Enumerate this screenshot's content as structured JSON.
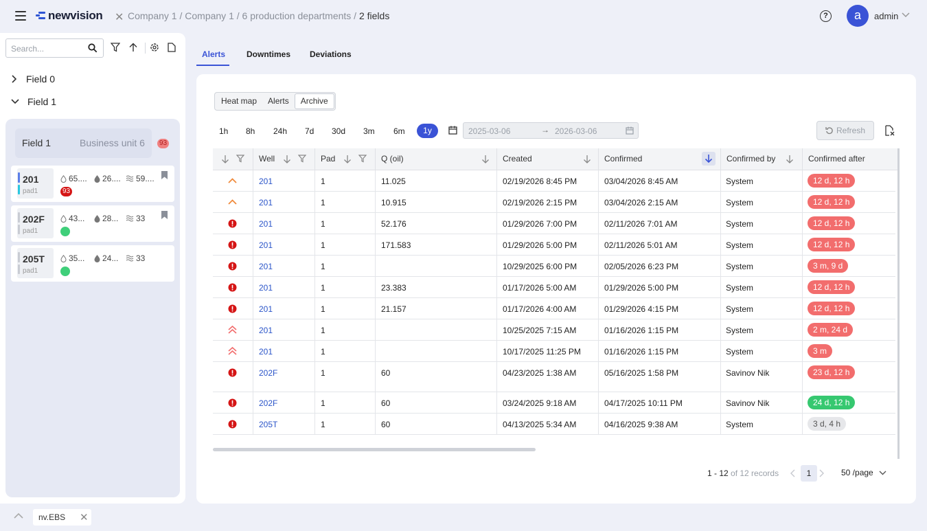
{
  "app": {
    "logo": "newvision"
  },
  "breadcrumb": {
    "parts": [
      "Company 1",
      "Company 1",
      "6 production departments"
    ],
    "current": "2 fields"
  },
  "user": {
    "avatar_letter": "a",
    "name": "admin"
  },
  "sidebar": {
    "search_placeholder": "Search...",
    "tree": [
      {
        "label": "Field 0"
      },
      {
        "label": "Field 1"
      }
    ],
    "field_header": {
      "name": "Field 1",
      "unit": "Business unit 6",
      "badge": "93"
    },
    "wells": [
      {
        "name": "201",
        "pad": "pad1",
        "oil": "65....",
        "water": "26....",
        "gas": "59....",
        "badge": "93",
        "status": "alert",
        "bar_top": "#5b7ee8",
        "bar_bottom": "#2ac8e0"
      },
      {
        "name": "202F",
        "pad": "pad1",
        "oil": "43...",
        "water": "28...",
        "gas": "33",
        "status": "ok",
        "bar_top": "#c9ccd3",
        "bar_bottom": "#c9ccd3"
      },
      {
        "name": "205T",
        "pad": "pad1",
        "oil": "35...",
        "water": "24...",
        "gas": "33",
        "status": "ok",
        "bar_top": "#c9ccd3",
        "bar_bottom": "#c9ccd3"
      }
    ]
  },
  "tray": {
    "tab_label": "nv.EBS"
  },
  "tabs": [
    {
      "label": "Alerts",
      "active": true
    },
    {
      "label": "Downtimes"
    },
    {
      "label": "Deviations"
    }
  ],
  "view_toggle": [
    "Heat map",
    "Alerts",
    "Archive"
  ],
  "view_selected": "Archive",
  "periods": [
    "1h",
    "8h",
    "24h",
    "7d",
    "30d",
    "3m",
    "6m",
    "1y"
  ],
  "period_selected": "1y",
  "date_range": {
    "from": "2025-03-06",
    "to": "2026-03-06"
  },
  "refresh_label": "Refresh",
  "columns": {
    "well": "Well",
    "pad": "Pad",
    "q_oil": "Q (oil)",
    "created": "Created",
    "confirmed": "Confirmed",
    "confirmed_by": "Confirmed by",
    "confirmed_after": "Confirmed after"
  },
  "rows": [
    {
      "sev": "warning",
      "well": "201",
      "pad": "1",
      "q": "11.025",
      "created": "02/19/2026 8:45 PM",
      "confirmed": "03/04/2026 8:45 AM",
      "by": "System",
      "after": "12 d, 12 h",
      "tone": "red"
    },
    {
      "sev": "warning",
      "well": "201",
      "pad": "1",
      "q": "10.915",
      "created": "02/19/2026 2:15 PM",
      "confirmed": "03/04/2026 2:15 AM",
      "by": "System",
      "after": "12 d, 12 h",
      "tone": "red"
    },
    {
      "sev": "critical",
      "well": "201",
      "pad": "1",
      "q": "52.176",
      "created": "01/29/2026 7:00 PM",
      "confirmed": "02/11/2026 7:01 AM",
      "by": "System",
      "after": "12 d, 12 h",
      "tone": "red"
    },
    {
      "sev": "critical",
      "well": "201",
      "pad": "1",
      "q": "171.583",
      "created": "01/29/2026 5:00 PM",
      "confirmed": "02/11/2026 5:01 AM",
      "by": "System",
      "after": "12 d, 12 h",
      "tone": "red"
    },
    {
      "sev": "critical",
      "well": "201",
      "pad": "1",
      "q": "",
      "created": "10/29/2025 6:00 PM",
      "confirmed": "02/05/2026 6:23 PM",
      "by": "System",
      "after": "3 m, 9 d",
      "tone": "red"
    },
    {
      "sev": "critical",
      "well": "201",
      "pad": "1",
      "q": "23.383",
      "created": "01/17/2026 5:00 AM",
      "confirmed": "01/29/2026 5:00 PM",
      "by": "System",
      "after": "12 d, 12 h",
      "tone": "red"
    },
    {
      "sev": "critical",
      "well": "201",
      "pad": "1",
      "q": "21.157",
      "created": "01/17/2026 4:00 AM",
      "confirmed": "01/29/2026 4:15 PM",
      "by": "System",
      "after": "12 d, 12 h",
      "tone": "red"
    },
    {
      "sev": "high",
      "well": "201",
      "pad": "1",
      "q": "",
      "created": "10/25/2025 7:15 AM",
      "confirmed": "01/16/2026 1:15 PM",
      "by": "System",
      "after": "2 m, 24 d",
      "tone": "red"
    },
    {
      "sev": "high",
      "well": "201",
      "pad": "1",
      "q": "",
      "created": "10/17/2025 11:25 PM",
      "confirmed": "01/16/2026 1:15 PM",
      "by": "System",
      "after": "3 m",
      "tone": "red"
    },
    {
      "sev": "critical",
      "well": "202F",
      "pad": "1",
      "q": "60",
      "created": "04/23/2025 1:38 AM",
      "confirmed": "05/16/2025 1:58 PM",
      "by": "Savinov Nik",
      "after": "23 d, 12 h",
      "tone": "red",
      "tall": true
    },
    {
      "sev": "critical",
      "well": "202F",
      "pad": "1",
      "q": "60",
      "created": "03/24/2025 9:18 AM",
      "confirmed": "04/17/2025 10:11 PM",
      "by": "Savinov Nik",
      "after": "24 d, 12 h",
      "tone": "green"
    },
    {
      "sev": "critical",
      "well": "205T",
      "pad": "1",
      "q": "60",
      "created": "04/13/2025 5:34 AM",
      "confirmed": "04/16/2025 9:38 AM",
      "by": "System",
      "after": "3 d, 4 h",
      "tone": "gray"
    }
  ],
  "pagination": {
    "range": "1 - 12",
    "of_label": "of 12 records",
    "page": "1",
    "page_size": "50 /page"
  },
  "colors": {
    "accent": "#3a53d6",
    "critical": "#d51515",
    "warning": "#f08a3c",
    "high": "#f26d6d"
  }
}
